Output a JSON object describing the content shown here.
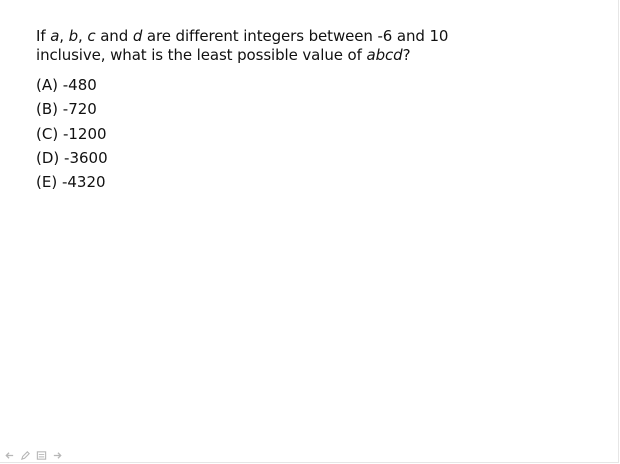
{
  "question": {
    "part1": "If ",
    "var_a": "a",
    "sep1": ", ",
    "var_b": "b",
    "sep2": ", ",
    "var_c": "c",
    "sep3": " and ",
    "var_d": "d",
    "part2": " are different integers between -6 and 10",
    "part3": "inclusive, what is the least possible value of ",
    "var_abcd": "abcd",
    "part4": "?"
  },
  "choices": [
    {
      "label": "(A)",
      "value": "-480"
    },
    {
      "label": "(B)",
      "value": "-720"
    },
    {
      "label": "(C)",
      "value": "-1200"
    },
    {
      "label": "(D)",
      "value": "-3600"
    },
    {
      "label": "(E)",
      "value": "-4320"
    }
  ],
  "toolbar": {
    "icons": [
      "back-arrow-icon",
      "pen-icon",
      "slide-menu-icon",
      "forward-arrow-icon"
    ]
  }
}
